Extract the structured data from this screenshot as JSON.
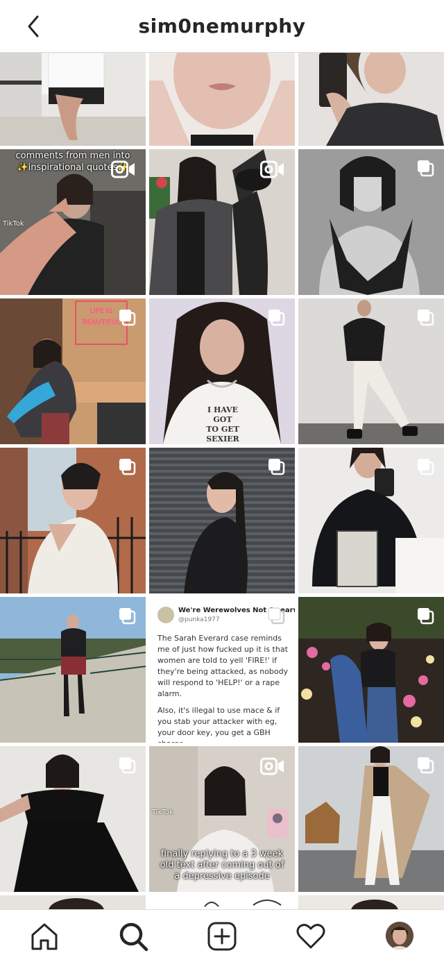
{
  "header": {
    "username": "sim0nemurphy"
  },
  "posts": [
    {
      "type": "photo"
    },
    {
      "type": "photo"
    },
    {
      "type": "photo"
    },
    {
      "type": "reel",
      "caption_line1": "comments from men into",
      "caption_line2": "✨inspirational quotes✨",
      "app_label": "TikTok"
    },
    {
      "type": "reel"
    },
    {
      "type": "carousel"
    },
    {
      "type": "carousel",
      "sign_text_1": "LIFE IS",
      "sign_text_2": "BEAUTIFUL"
    },
    {
      "type": "carousel",
      "shirt_text_1": "I HAVE GOT",
      "shirt_text_2": "TO GET",
      "shirt_text_3": "SEXIER"
    },
    {
      "type": "carousel"
    },
    {
      "type": "carousel"
    },
    {
      "type": "carousel"
    },
    {
      "type": "carousel"
    },
    {
      "type": "carousel"
    },
    {
      "type": "carousel",
      "tweet": {
        "display_name": "We're Werewolves Not Swearwol",
        "handle": "@punka1977",
        "paragraph_1": "The Sarah Everard case reminds me of just how fucked up it is that women are told to yell 'FIRE!' if they're being attacked, as nobody will respond to 'HELP!' or a rape alarm.",
        "paragraph_2": "Also, it's illegal to use mace & if you stab your attacker with eg, your door key, you get a GBH charge"
      }
    },
    {
      "type": "carousel"
    },
    {
      "type": "carousel"
    },
    {
      "type": "reel",
      "app_label": "TikTok",
      "caption_line1": "finally replying to a 3 week",
      "caption_line2": "old text after coming out of",
      "caption_line3": "a depressive episode"
    },
    {
      "type": "carousel"
    }
  ],
  "icons": {
    "back": "chevron-left-icon",
    "reel_badge": "video-camera-icon",
    "carousel_badge": "multiple-photos-icon",
    "home": "home-icon",
    "search": "search-icon",
    "create": "plus-square-icon",
    "activity": "heart-icon",
    "profile": "profile-avatar"
  },
  "nav": {
    "active_tab": "search"
  },
  "colors": {
    "text": "#262626",
    "divider": "#dbdbdb",
    "background": "#ffffff"
  }
}
